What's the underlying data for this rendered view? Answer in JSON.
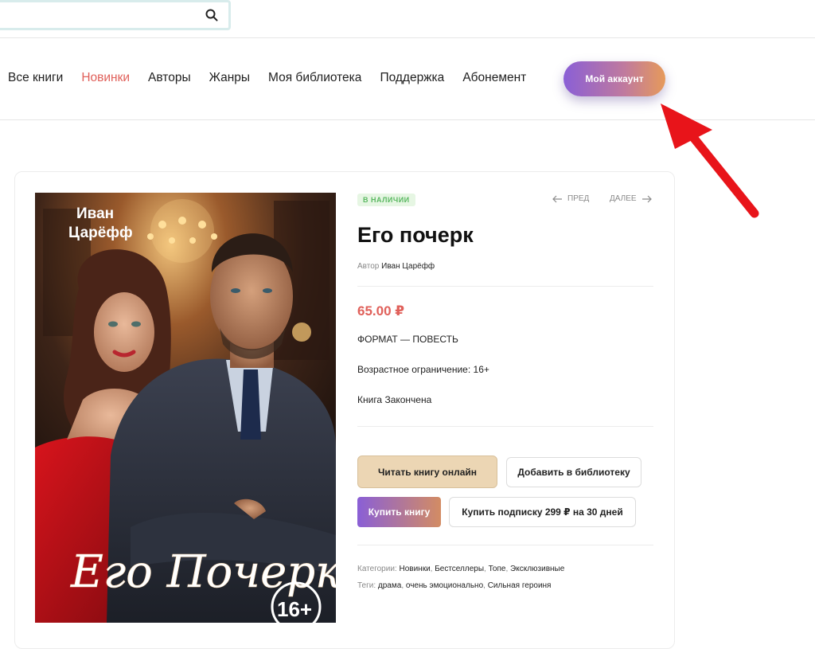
{
  "search": {
    "placeholder": "",
    "value": "",
    "button_icon": "search-icon"
  },
  "nav": {
    "items": [
      {
        "label": "Все книги",
        "active": false
      },
      {
        "label": "Новинки",
        "active": true
      },
      {
        "label": "Авторы",
        "active": false
      },
      {
        "label": "Жанры",
        "active": false
      },
      {
        "label": "Моя библиотека",
        "active": false
      },
      {
        "label": "Поддержка",
        "active": false
      },
      {
        "label": "Абонемент",
        "active": false
      }
    ],
    "account_label": "Мой аккаунт",
    "accent_color": "#e0605a"
  },
  "book": {
    "status_badge": "В НАЛИЧИИ",
    "prev_label": "ПРЕД",
    "next_label": "ДАЛЕЕ",
    "title": "Его почерк",
    "author_prefix": "Автор",
    "author_name": "Иван Царёфф",
    "price": "65.00 ₽",
    "format": "ФОРМАТ — ПОВЕСТЬ",
    "age_limit": "Возрастное ограничение: 16+",
    "status": "Книга Закончена",
    "read_label": "Читать книгу онлайн",
    "add_library_label": "Добавить в библиотеку",
    "buy_label": "Купить книгу",
    "subscription_label": "Купить подписку 299 ₽ на 30 дней",
    "categories_label": "Категории:",
    "categories": [
      "Новинки",
      "Бестселлеры",
      "Топе",
      "Эксклюзивные"
    ],
    "tags_label": "Теги:",
    "tags": [
      "драма",
      "очень эмоционально",
      "Сильная героиня"
    ],
    "cover": {
      "author_text_line1": "Иван",
      "author_text_line2": "Царёфф",
      "title_text": "Его Почерк",
      "age_badge": "16+"
    }
  }
}
